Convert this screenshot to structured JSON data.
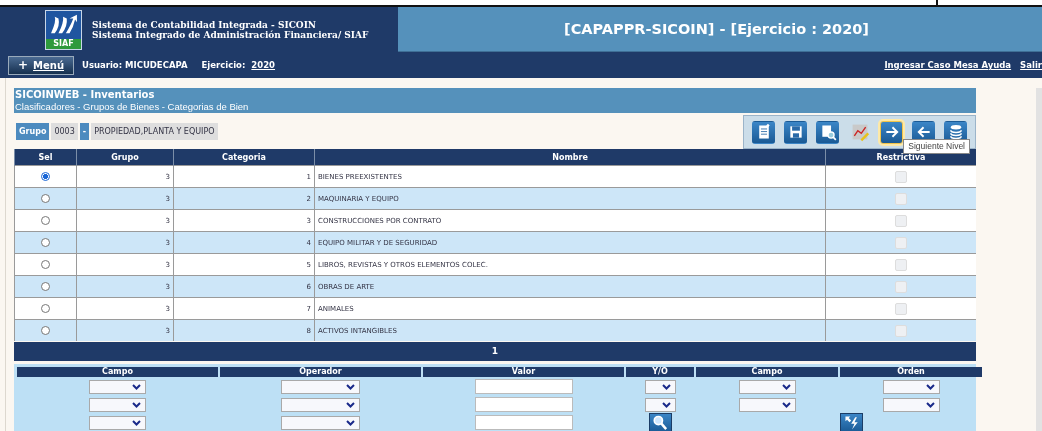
{
  "header": {
    "logo_text": "SIAF",
    "system_lines": [
      "Sistema de Contabilidad Integrada - SICOIN",
      "Sistema Integrado de Administración Financiera/ SIAF"
    ],
    "title": "[CAPAPPR-SICOIN] - [Ejercicio : 2020]"
  },
  "nav": {
    "menu_icon": "+",
    "menu_label": "Menú",
    "user": "Usuario: MICUDECAPA",
    "year_label": "Ejercicio:",
    "year": "2020",
    "links": [
      "Ingresar Caso Mesa Ayuda",
      "Salir"
    ]
  },
  "panel": {
    "title": "SICOINWEB - Inventarios",
    "breadcrumb": "Clasificadores - Grupos de Bienes - Categorias de Bien"
  },
  "group": {
    "label": "Grupo",
    "code": "0003",
    "separator": "-",
    "name": "PROPIEDAD,PLANTA Y EQUIPO"
  },
  "toolbar": [
    {
      "kind": "new",
      "highlighted": false
    },
    {
      "kind": "save",
      "highlighted": false
    },
    {
      "kind": "preview",
      "highlighted": false
    },
    {
      "kind": "chart",
      "highlighted": false
    },
    {
      "kind": "next",
      "highlighted": true
    },
    {
      "kind": "back",
      "highlighted": false
    },
    {
      "kind": "database",
      "highlighted": false
    }
  ],
  "tooltip": "Siguiente Nivel",
  "table": {
    "columns": [
      "Sel",
      "Grupo",
      "Categoria",
      "Nombre",
      "Restrictiva"
    ],
    "rows": [
      {
        "selected": true,
        "grupo": "3",
        "categoria": "1",
        "nombre": "BIENES PREEXISTENTES",
        "restrictiva": false
      },
      {
        "selected": false,
        "grupo": "3",
        "categoria": "2",
        "nombre": "MAQUINARIA Y EQUIPO",
        "restrictiva": false
      },
      {
        "selected": false,
        "grupo": "3",
        "categoria": "3",
        "nombre": "CONSTRUCCIONES POR CONTRATO",
        "restrictiva": false
      },
      {
        "selected": false,
        "grupo": "3",
        "categoria": "4",
        "nombre": "EQUIPO MILITAR Y DE SEGURIDAD",
        "restrictiva": false
      },
      {
        "selected": false,
        "grupo": "3",
        "categoria": "5",
        "nombre": "LIBROS, REVISTAS Y OTROS ELEMENTOS COLEC.",
        "restrictiva": false
      },
      {
        "selected": false,
        "grupo": "3",
        "categoria": "6",
        "nombre": "OBRAS DE ARTE",
        "restrictiva": false
      },
      {
        "selected": false,
        "grupo": "3",
        "categoria": "7",
        "nombre": "ANIMALES",
        "restrictiva": false
      },
      {
        "selected": false,
        "grupo": "3",
        "categoria": "8",
        "nombre": "ACTIVOS INTANGIBLES",
        "restrictiva": false
      }
    ],
    "pager": "1"
  },
  "filter": {
    "columns": [
      {
        "label": "Campo",
        "controls": [
          {
            "kind": "select"
          },
          {
            "kind": "select"
          },
          {
            "kind": "select"
          }
        ]
      },
      {
        "label": "Operador",
        "controls": [
          {
            "kind": "select"
          },
          {
            "kind": "select"
          },
          {
            "kind": "select"
          }
        ]
      },
      {
        "label": "Valor",
        "controls": [
          {
            "kind": "input"
          },
          {
            "kind": "input"
          },
          {
            "kind": "input"
          }
        ]
      },
      {
        "label": "Y/O",
        "controls": [
          {
            "kind": "select"
          },
          {
            "kind": "select"
          },
          {
            "kind": "search"
          }
        ]
      },
      {
        "label": "Campo",
        "controls": [
          {
            "kind": "select"
          },
          {
            "kind": "select"
          }
        ]
      },
      {
        "label": "Orden",
        "controls": [
          {
            "kind": "select"
          },
          {
            "kind": "select"
          },
          {
            "kind": "apply"
          }
        ]
      }
    ]
  }
}
